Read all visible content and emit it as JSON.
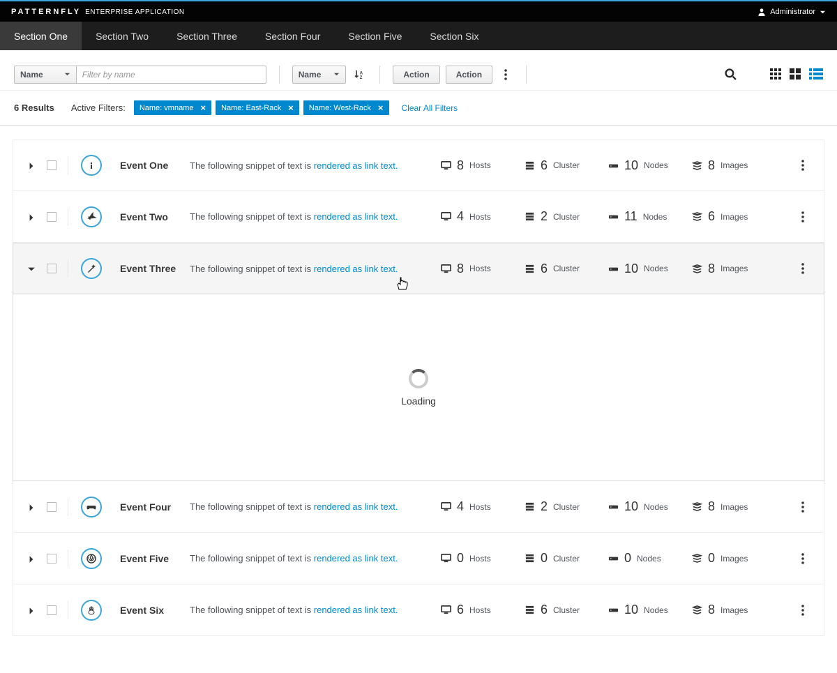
{
  "brand": {
    "name": "PATTERNFLY",
    "sub": "ENTERPRISE APPLICATION"
  },
  "user": {
    "label": "Administrator"
  },
  "nav": {
    "tabs": [
      "Section One",
      "Section Two",
      "Section Three",
      "Section Four",
      "Section Five",
      "Section Six"
    ],
    "active": 0
  },
  "toolbar": {
    "filter_attr": "Name",
    "filter_placeholder": "Filter by name",
    "sort_attr": "Name",
    "action1": "Action",
    "action2": "Action"
  },
  "filters": {
    "results": "6 Results",
    "label": "Active Filters:",
    "chips": [
      "Name: vmname",
      "Name: East-Rack",
      "Name: West-Rack"
    ],
    "clear": "Clear All Filters"
  },
  "row_template": {
    "desc_prefix": "The following snippet of text is ",
    "desc_link": "rendered as link text.",
    "labels": {
      "hosts": "Hosts",
      "cluster": "Cluster",
      "nodes": "Nodes",
      "images": "Images"
    }
  },
  "rows": [
    {
      "title": "Event One",
      "icon": "info",
      "hosts": 8,
      "cluster": 6,
      "nodes": 10,
      "images": 8,
      "expanded": false
    },
    {
      "title": "Event Two",
      "icon": "plane",
      "hosts": 4,
      "cluster": 2,
      "nodes": 11,
      "images": 6,
      "expanded": false
    },
    {
      "title": "Event Three",
      "icon": "wand",
      "hosts": 8,
      "cluster": 6,
      "nodes": 10,
      "images": 8,
      "expanded": true
    },
    {
      "title": "Event Four",
      "icon": "gamepad",
      "hosts": 4,
      "cluster": 2,
      "nodes": 10,
      "images": 8,
      "expanded": false
    },
    {
      "title": "Event Five",
      "icon": "rebel",
      "hosts": 0,
      "cluster": 0,
      "nodes": 0,
      "images": 0,
      "expanded": false
    },
    {
      "title": "Event Six",
      "icon": "linux",
      "hosts": 6,
      "cluster": 6,
      "nodes": 10,
      "images": 8,
      "expanded": false
    }
  ],
  "loading": "Loading",
  "colors": {
    "link": "#0088ce",
    "accent": "#39a5dc"
  }
}
